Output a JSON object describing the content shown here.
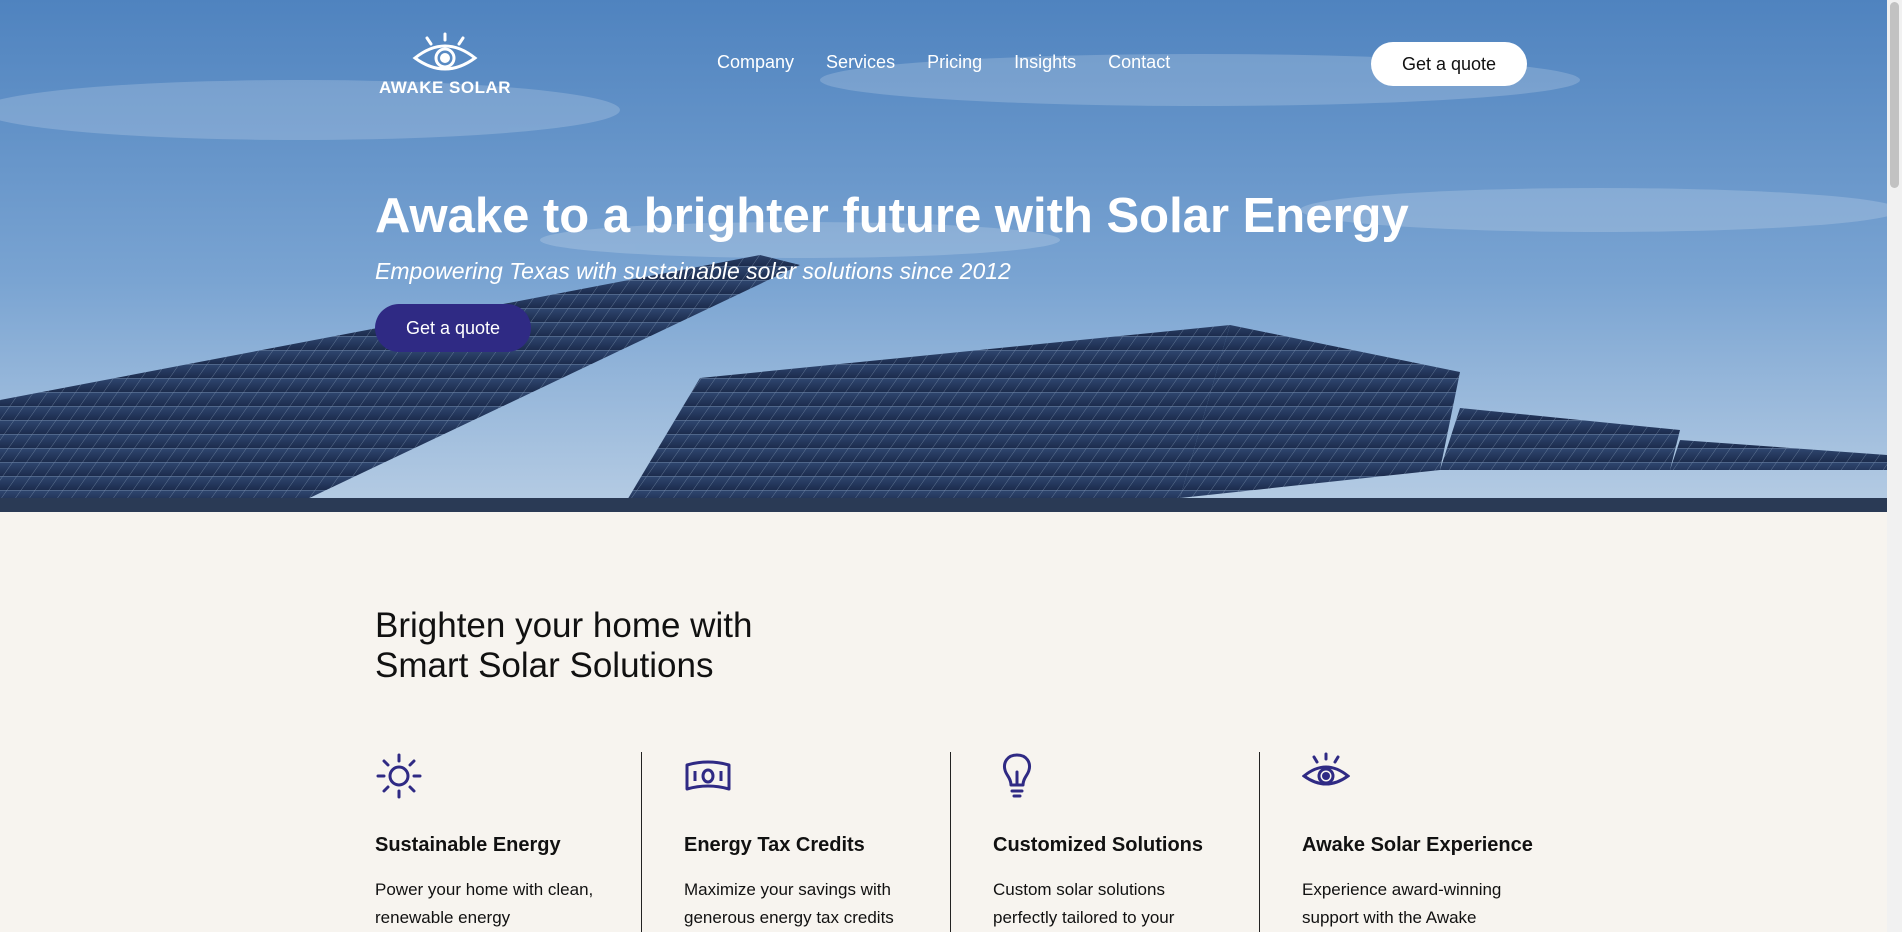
{
  "brand": {
    "name": "AWAKE SOLAR"
  },
  "nav": {
    "items": [
      "Company",
      "Services",
      "Pricing",
      "Insights",
      "Contact"
    ],
    "cta_label": "Get a quote"
  },
  "hero": {
    "title": "Awake to a brighter future with Solar Energy",
    "subtitle": "Empowering Texas with sustainable solar solutions since 2012",
    "cta_label": "Get a quote"
  },
  "features_section": {
    "title_line1": "Brighten your home with",
    "title_line2": "Smart Solar Solutions",
    "items": [
      {
        "icon": "sun-icon",
        "title": "Sustainable Energy",
        "text": "Power your home with clean, renewable energy"
      },
      {
        "icon": "money-icon",
        "title": "Energy Tax Credits",
        "text": "Maximize your savings with generous energy tax credits"
      },
      {
        "icon": "lightbulb-icon",
        "title": "Customized Solutions",
        "text": "Custom solar solutions perfectly tailored to your"
      },
      {
        "icon": "eye-icon",
        "title": "Awake Solar Experience",
        "text": "Experience award-winning support with the Awake"
      }
    ]
  },
  "colors": {
    "accent": "#2f2a84",
    "page_background": "#f7f4ef",
    "icon": "#2f2a84"
  }
}
